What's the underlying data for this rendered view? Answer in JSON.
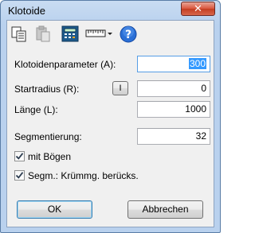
{
  "window": {
    "title": "Klotoide",
    "close_glyph": "✕"
  },
  "toolbar": {
    "icons": [
      "copy-icon",
      "paste-icon",
      "calculator-icon",
      "ruler-dropdown-icon",
      "help-icon"
    ],
    "help_glyph": "?"
  },
  "form": {
    "param_label": "Klotoidenparameter (A):",
    "param_value": "300",
    "radius_label": "Startradius (R):",
    "radius_button": "I",
    "radius_value": "0",
    "length_label": "Länge (L):",
    "length_value": "1000",
    "seg_label": "Segmentierung:",
    "seg_value": "32"
  },
  "options": {
    "arcs_label": "mit Bögen",
    "arcs_checked": true,
    "curv_label": "Segm.: Krümmg. berücks.",
    "curv_checked": true
  },
  "buttons": {
    "ok": "OK",
    "cancel": "Abbrechen"
  },
  "colors": {
    "selection": "#3399ff",
    "help_icon": "#2a6fd6"
  }
}
